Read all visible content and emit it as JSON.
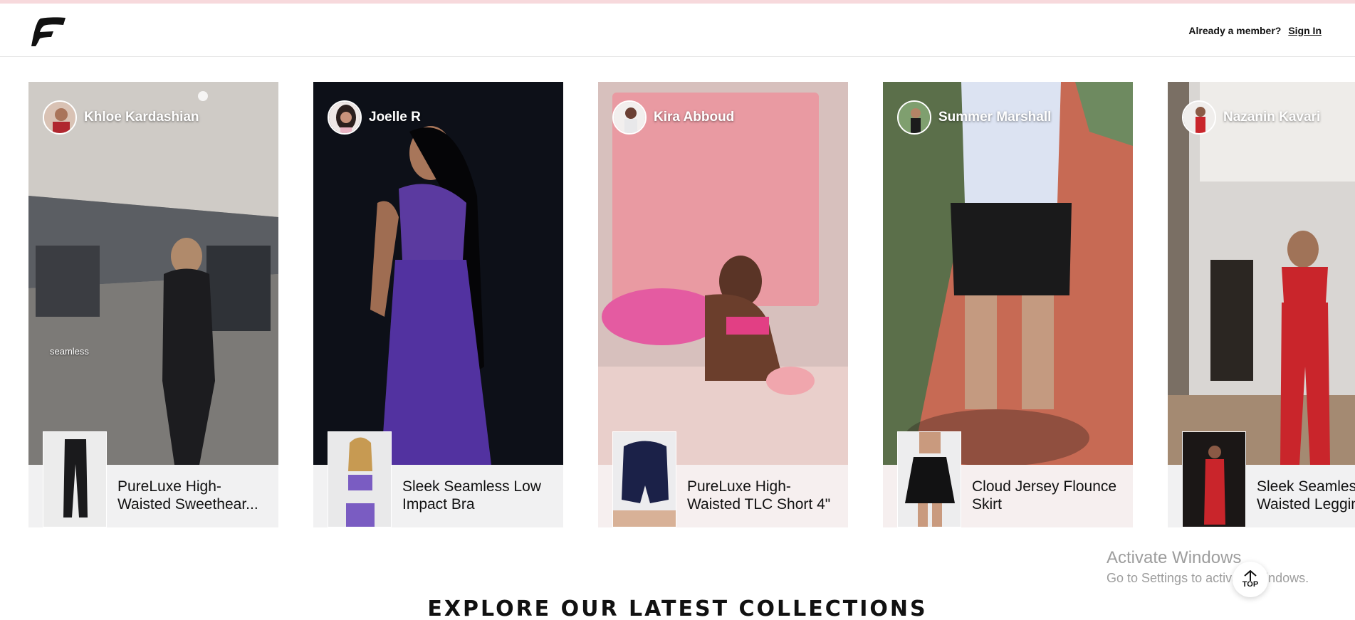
{
  "header": {
    "member_prompt": "Already a member?",
    "sign_in_label": "Sign In"
  },
  "cards": [
    {
      "creator": "Khloe Kardashian",
      "product": "PureLuxe High-Waisted Sweethear...",
      "overlay_tag": "seamless"
    },
    {
      "creator": "Joelle R",
      "product": "Sleek Seamless Low Impact Bra"
    },
    {
      "creator": "Kira Abboud",
      "product": "PureLuxe High-Waisted TLC Short 4\""
    },
    {
      "creator": "Summer Marshall",
      "product": "Cloud Jersey Flounce Skirt"
    },
    {
      "creator": "Nazanin Kavari",
      "product": "Sleek Seamless High-Waisted Leggings"
    }
  ],
  "windows_notice": {
    "line1": "Activate Windows",
    "line2": "Go to Settings to activate Windows."
  },
  "back_to_top_label": "TOP",
  "section_title": "EXPLORE OUR LATEST COLLECTIONS",
  "colors": {
    "top_strip": "#f7d9dc",
    "product_bar": "#f1f1f2",
    "text": "#111111"
  }
}
